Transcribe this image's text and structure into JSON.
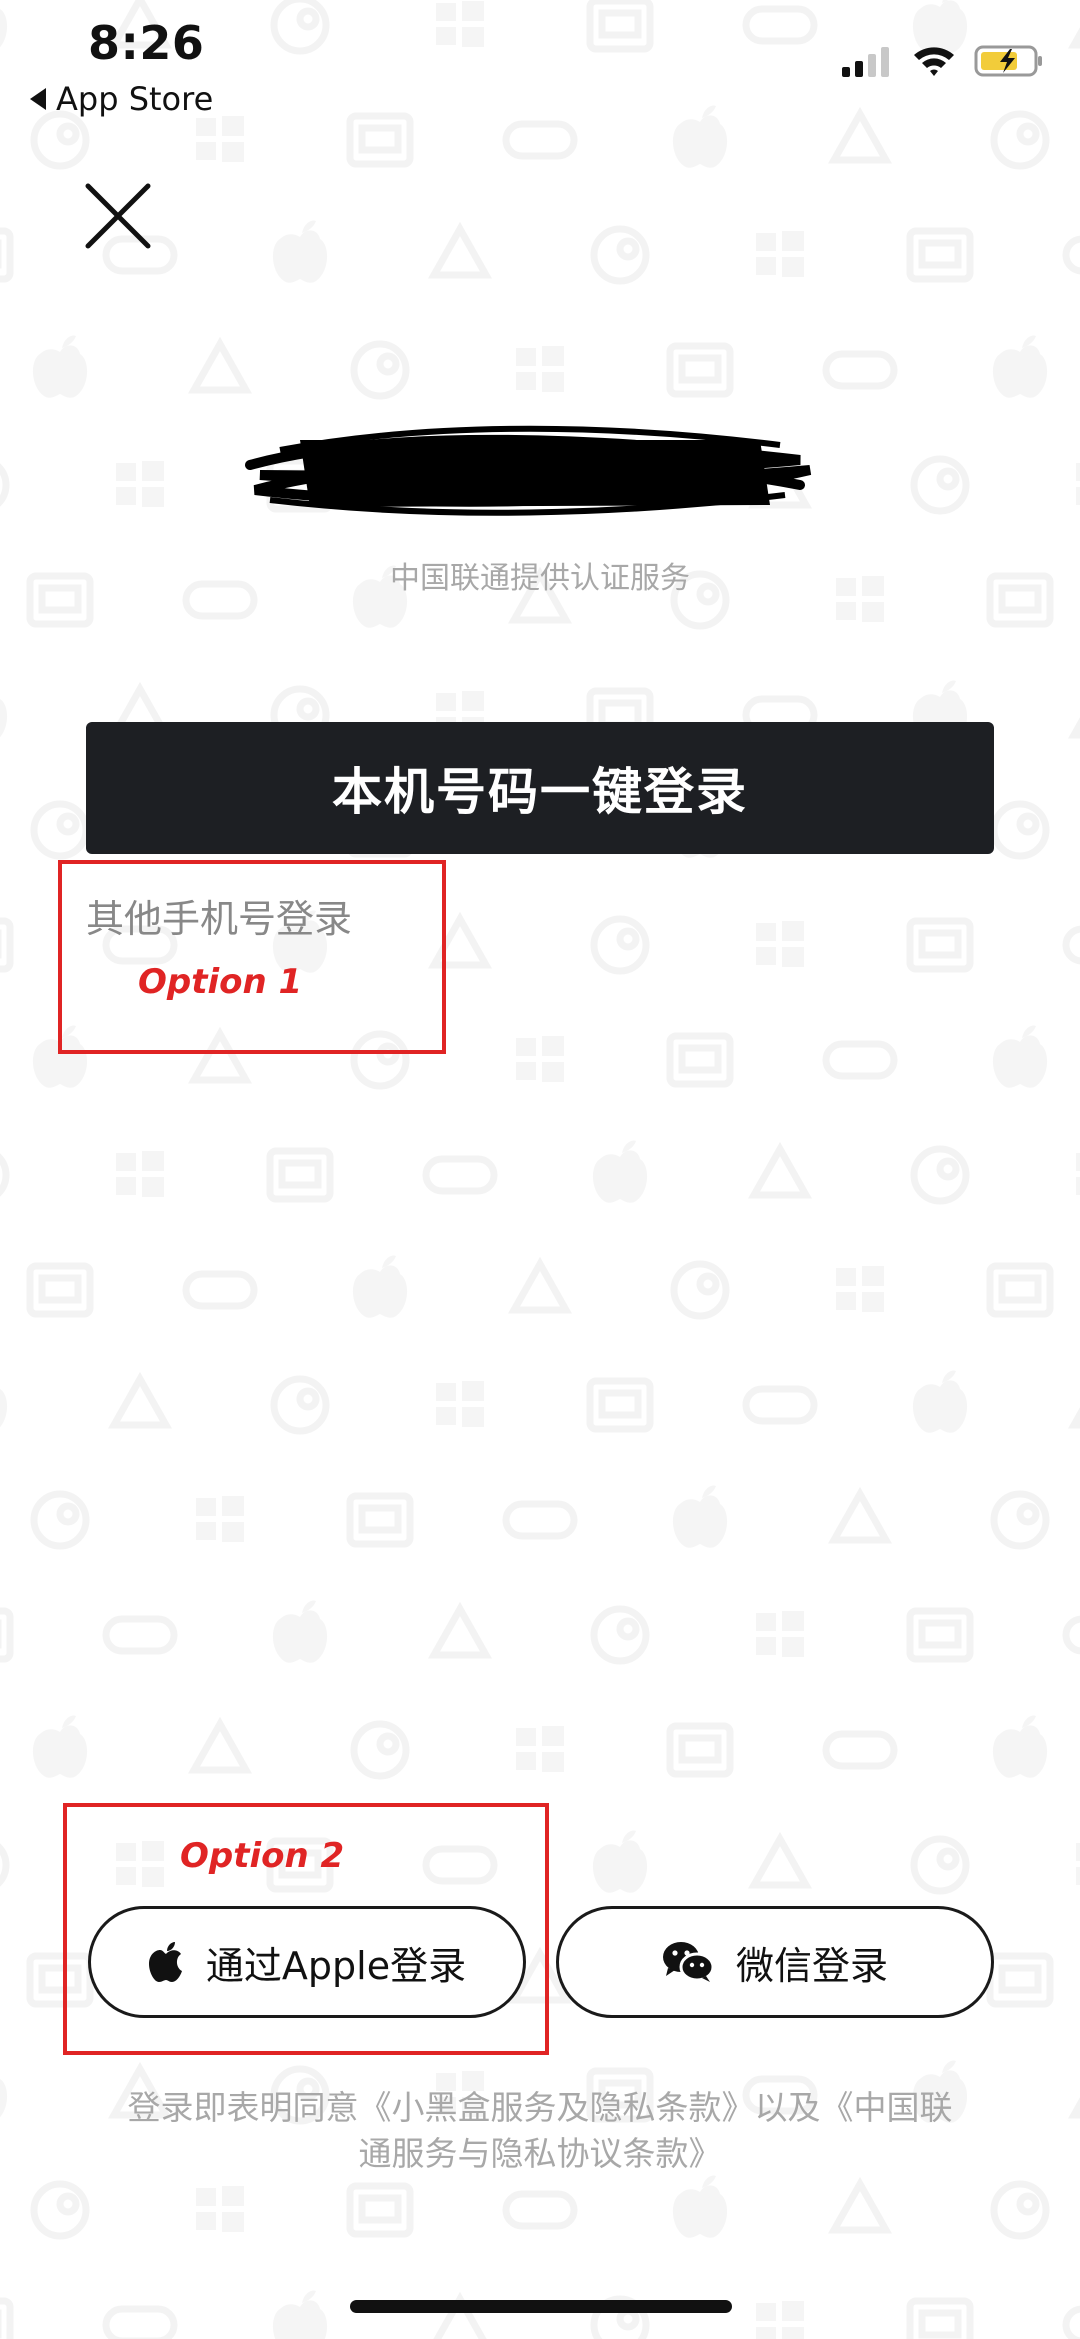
{
  "status_bar": {
    "time": "8:26",
    "back_app": "App Store",
    "icons": [
      "signal-icon",
      "wifi-icon",
      "battery-charging-icon"
    ]
  },
  "header": {
    "close_icon": "close-icon"
  },
  "auth": {
    "provider_text": "中国联通提供认证服务",
    "one_click_login": "本机号码一键登录",
    "other_phone_login": "其他手机号登录"
  },
  "annotations": {
    "option1": "Option 1",
    "option2": "Option 2",
    "color": "#e02424"
  },
  "social_login": {
    "apple": {
      "label": "通过Apple登录",
      "icon": "apple-icon"
    },
    "wechat": {
      "label": "微信登录",
      "icon": "wechat-icon"
    }
  },
  "terms": {
    "line1": "登录即表明同意《小黑盒服务及隐私条款》以及《中国联",
    "line2": "通服务与隐私协议条款》"
  },
  "colors": {
    "primary_button_bg": "#1d1f23",
    "muted_text": "#a8a8a8",
    "annotation": "#e02424"
  }
}
